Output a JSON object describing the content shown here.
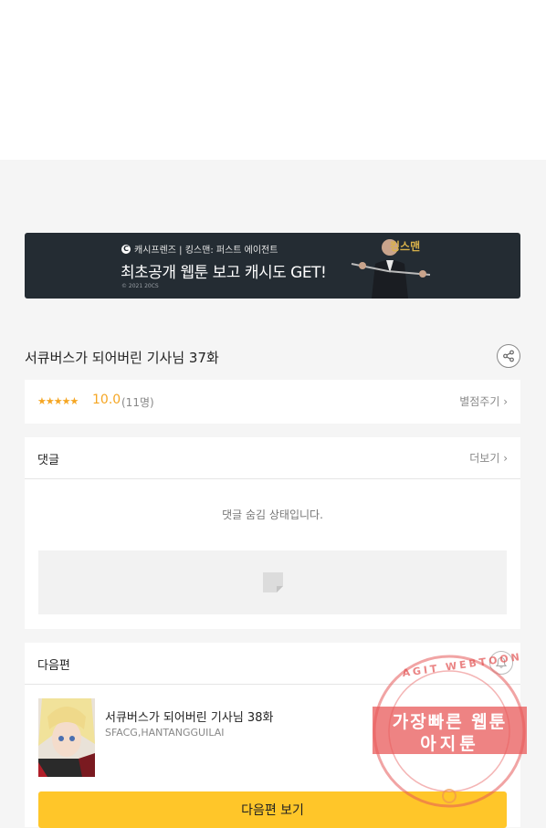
{
  "banner": {
    "brand": "캐시프렌즈 | 킹스맨: 퍼스트 에이전트",
    "headline": "최초공개 웹툰 보고 캐시도 GET!",
    "copyright": "© 2021 20CS",
    "movie_title": "킹스맨"
  },
  "episode": {
    "title": "서큐버스가 되어버린 기사님 37화",
    "share_icon": "share-icon"
  },
  "rating": {
    "stars": "★★★★★",
    "score": "10.0",
    "count": "(11명)",
    "rate_link": "별점주기 ›"
  },
  "comments": {
    "header": "댓글",
    "more_link": "더보기 ›",
    "hidden_message": "댓글 숨김 상태입니다."
  },
  "next": {
    "header": "다음편",
    "title": "서큐버스가 되어버린 기사님 38화",
    "authors": "SFACG,HANTANGGUILAI",
    "button": "다음편 보기",
    "bell_icon": "bell-icon"
  },
  "watermark": {
    "arc": "AGIT WEBTOON",
    "line1": "가장빠른 웹툰",
    "line2": "아지툰"
  },
  "colors": {
    "accent": "#ffc629",
    "star": "#f5a623",
    "banner_bg": "#242c33",
    "stamp": "#e85a5a"
  }
}
